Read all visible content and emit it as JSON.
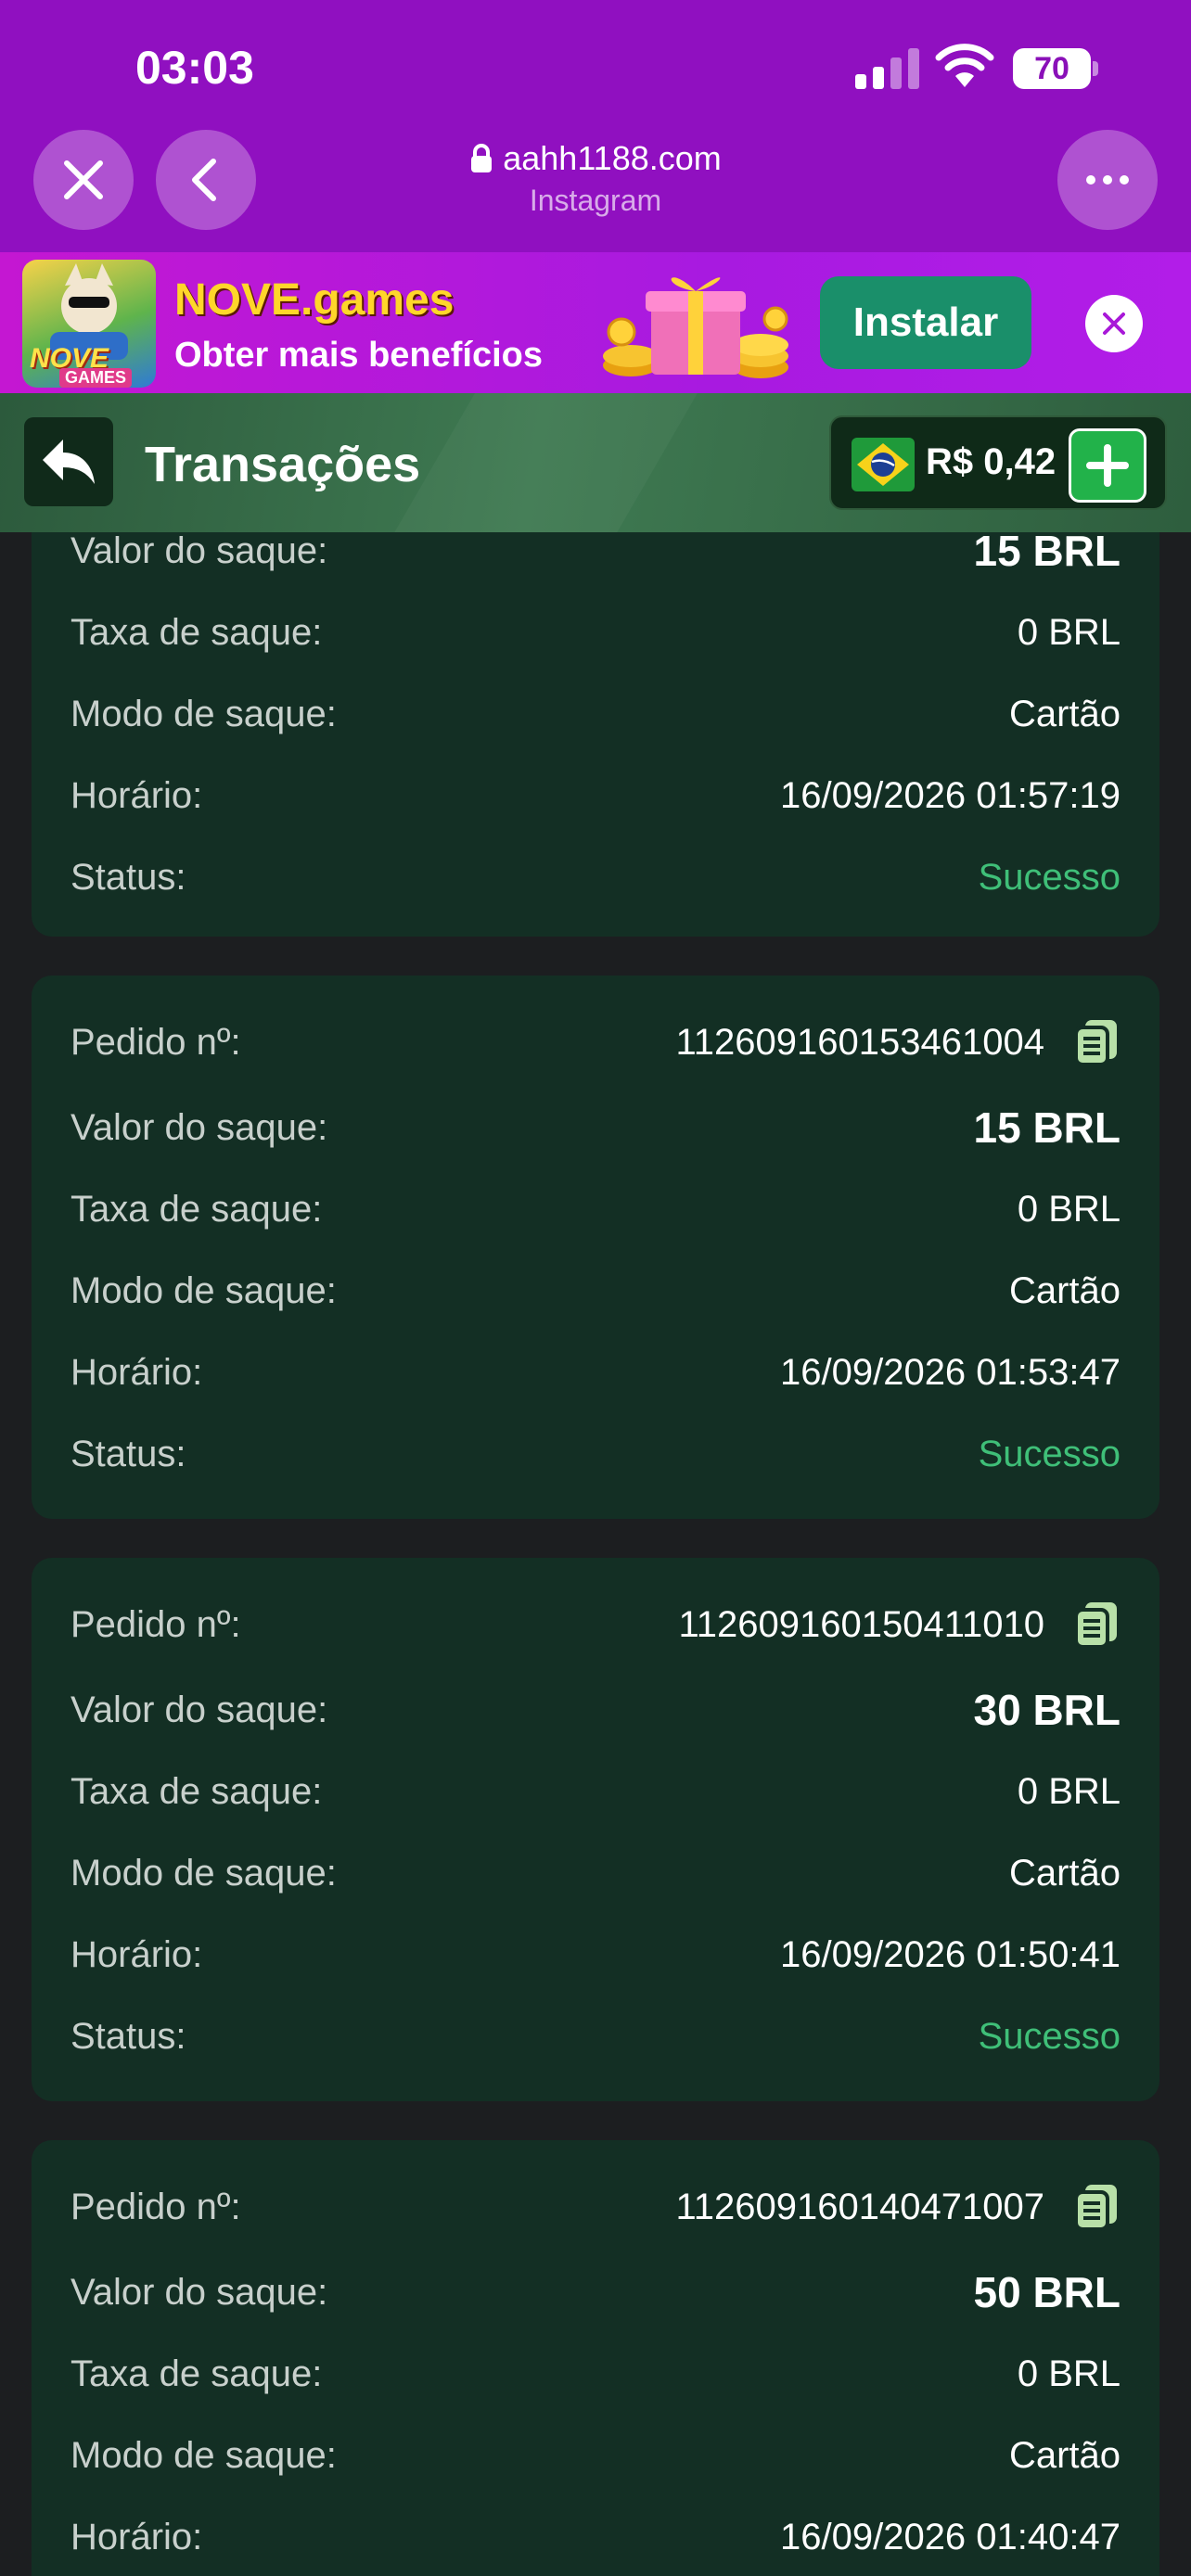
{
  "status_bar": {
    "time": "03:03",
    "battery": "70"
  },
  "browser": {
    "domain": "aahh1188.com",
    "source": "Instagram"
  },
  "promo": {
    "logo_word": "NOVE",
    "logo_sub": "GAMES",
    "title": "NOVE.games",
    "subtitle": "Obter mais benefícios",
    "install_label": "Instalar"
  },
  "header": {
    "title": "Transações",
    "balance": "R$ 0,42"
  },
  "labels": {
    "order": "Pedido nº:",
    "amount": "Valor do saque:",
    "fee": "Taxa de saque:",
    "mode": "Modo de saque:",
    "time": "Horário:",
    "status": "Status:"
  },
  "transactions": [
    {
      "order": "",
      "amount": "15 BRL",
      "fee": "0 BRL",
      "mode": "Cartão",
      "time": "16/09/2026 01:57:19",
      "status": "Sucesso"
    },
    {
      "order": "112609160153461004",
      "amount": "15 BRL",
      "fee": "0 BRL",
      "mode": "Cartão",
      "time": "16/09/2026 01:53:47",
      "status": "Sucesso"
    },
    {
      "order": "112609160150411010",
      "amount": "30 BRL",
      "fee": "0 BRL",
      "mode": "Cartão",
      "time": "16/09/2026 01:50:41",
      "status": "Sucesso"
    },
    {
      "order": "112609160140471007",
      "amount": "50 BRL",
      "fee": "0 BRL",
      "mode": "Cartão",
      "time": "16/09/2026 01:40:47",
      "status": ""
    }
  ],
  "colors": {
    "browser_bg": "#9010c0",
    "card_bg": "#132f24",
    "success": "#3fbf78",
    "page_bg": "#1c1e20"
  }
}
